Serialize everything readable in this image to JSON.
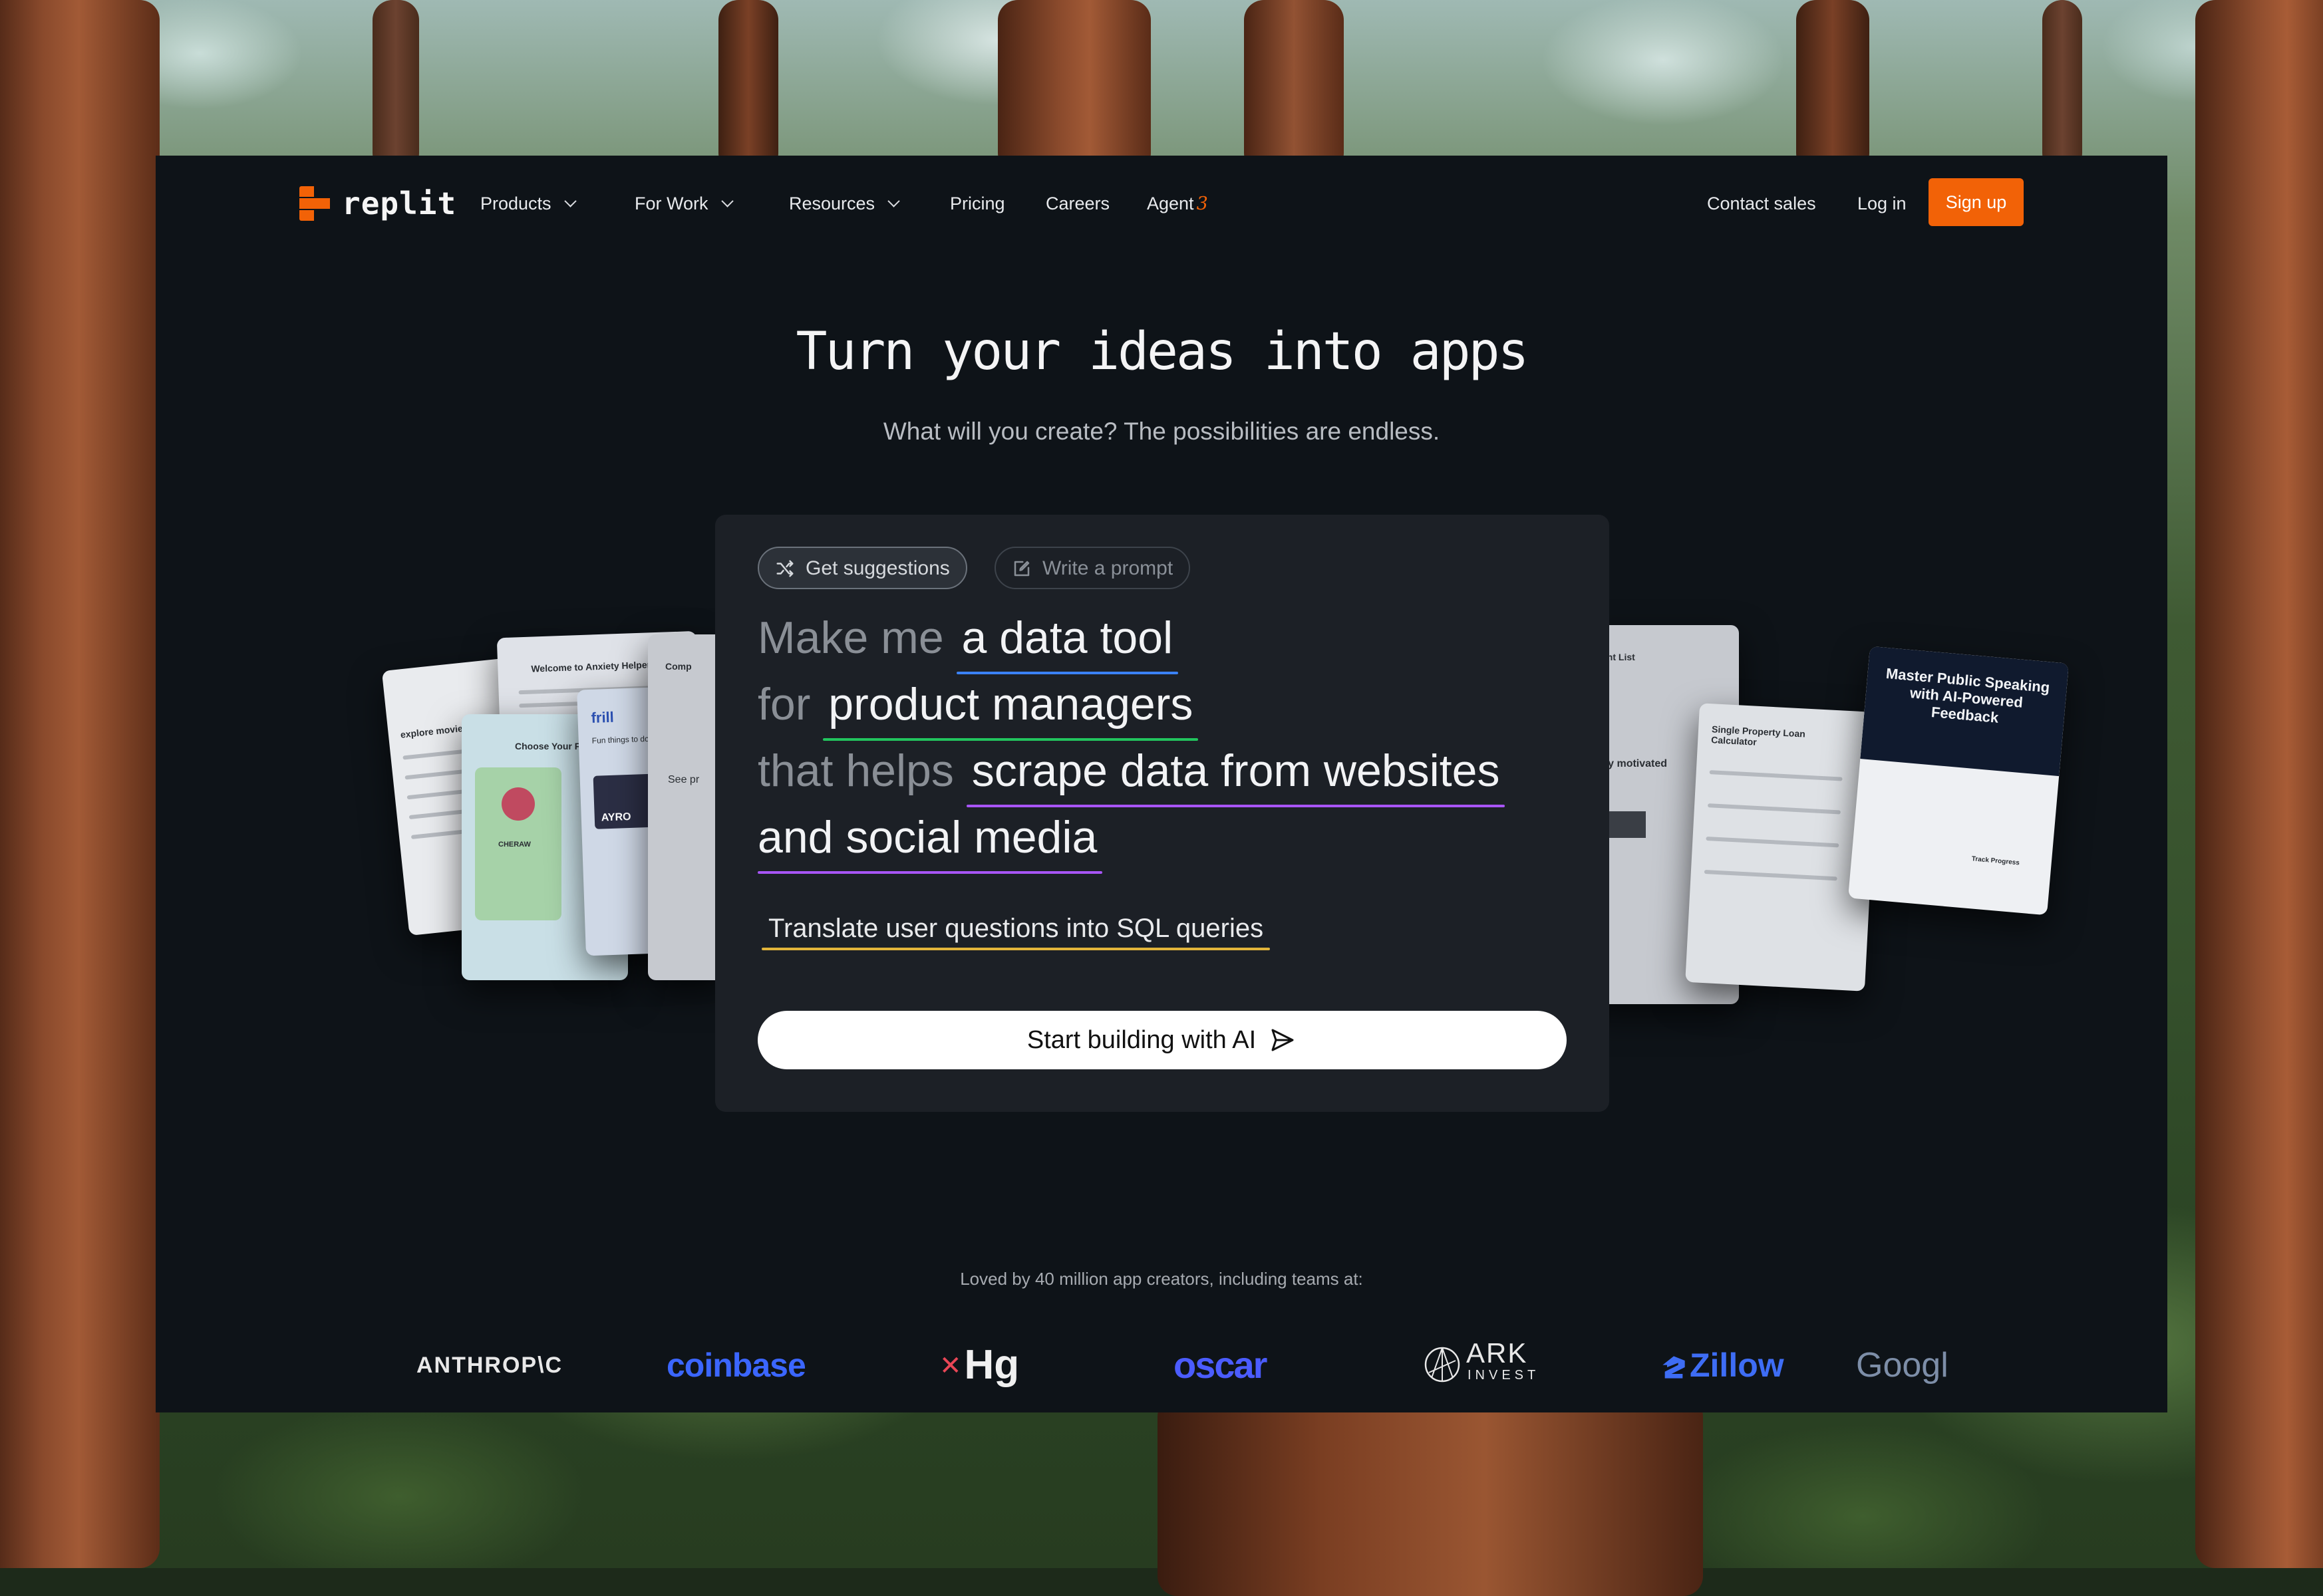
{
  "nav": {
    "logo_text": "replit",
    "items": [
      {
        "label": "Products"
      },
      {
        "label": "For Work"
      },
      {
        "label": "Resources"
      },
      {
        "label": "Pricing"
      },
      {
        "label": "Careers"
      },
      {
        "label": "Agent",
        "badge": "3"
      }
    ],
    "contact_sales": "Contact sales",
    "log_in": "Log in",
    "sign_up": "Sign up"
  },
  "hero": {
    "title": "Turn your ideas into apps",
    "subtitle": "What will you create? The possibilities are endless."
  },
  "prompt_box": {
    "mode_tabs": [
      {
        "label": "Get suggestions",
        "active": true
      },
      {
        "label": "Write a prompt",
        "active": false
      }
    ],
    "lines": [
      {
        "prefix": "Make me",
        "value": "a data tool",
        "underline_color": "#3b82f6"
      },
      {
        "prefix": "for",
        "value": "product managers",
        "underline_color": "#22c55e"
      },
      {
        "prefix": "that helps",
        "value": "scrape data from websites",
        "underline_color": "#a855f7"
      },
      {
        "prefix": "",
        "value": "and social media",
        "underline_color": "#a855f7"
      }
    ],
    "suggestion": "Translate user questions into SQL queries",
    "suggestion_underline_color": "#e2b53a",
    "start_button": "Start building with AI"
  },
  "preview_cards": {
    "left": [
      {
        "title": "explore movies b"
      },
      {
        "title": "Welcome to Anxiety Helper"
      },
      {
        "title": "Choose Your Fr"
      },
      {
        "title": "CHERAW"
      },
      {
        "title": "frill"
      },
      {
        "title": "Fun things to do in"
      },
      {
        "title": "AYRO"
      },
      {
        "title": "See pr"
      },
      {
        "title": "Comp"
      }
    ],
    "right": [
      {
        "title": "grant List"
      },
      {
        "title": "stay motivated"
      },
      {
        "title": "Single Property Loan Calculator"
      },
      {
        "title": "Master Public Speaking with AI-Powered Feedback"
      },
      {
        "title": "Track Progress"
      }
    ]
  },
  "social_proof": {
    "text": "Loved by 40 million app creators, including teams at:",
    "logos": [
      "ANTHROP\\C",
      "coinbase",
      "Hg",
      "oscar",
      "ARK",
      "INVEST",
      "Zillow",
      "Googl"
    ]
  },
  "colors": {
    "accent": "#f26207",
    "panel_bg": "#0e1318",
    "prompt_bg": "#1c2026"
  }
}
